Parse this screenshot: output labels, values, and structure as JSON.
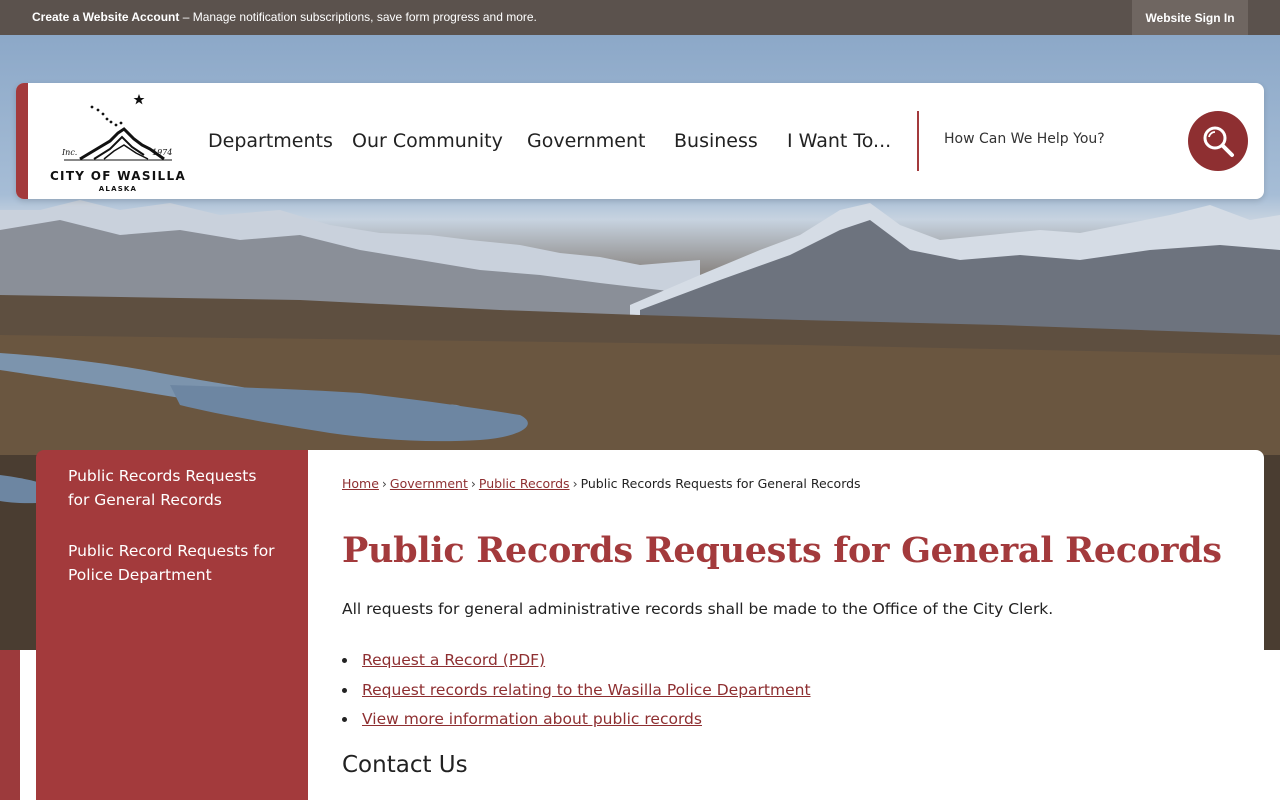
{
  "topbar": {
    "create_account": "Create a Website Account",
    "message": " – Manage notification subscriptions, save form progress and more.",
    "sign_in": "Website Sign In"
  },
  "logo": {
    "inc": "Inc.",
    "year": "1974",
    "city": "CITY OF WASILLA",
    "state": "ALASKA"
  },
  "nav": [
    "Departments",
    "Our Community",
    "Government",
    "Business",
    "I Want To..."
  ],
  "search": {
    "placeholder": "How Can We Help You?",
    "icon": "search-icon"
  },
  "sidebar": {
    "items": [
      "Public Records Requests for General Records",
      "Public Record Requests for Police Department"
    ]
  },
  "breadcrumb": {
    "home": "Home",
    "government": "Government",
    "public_records": "Public Records",
    "current": "Public Records Requests for General Records",
    "separator": "›"
  },
  "page": {
    "title": "Public Records Requests for General Records",
    "intro": "All requests for general administrative records shall be made to the Office of the City Clerk.",
    "links": [
      "Request a Record (PDF)",
      "Request records relating to the Wasilla Police Department",
      "View more information about public records"
    ],
    "contact_heading": "Contact Us"
  },
  "colors": {
    "brand": "#a33a3c",
    "brand_dark": "#8e2f31",
    "topbar": "#5b524d"
  }
}
